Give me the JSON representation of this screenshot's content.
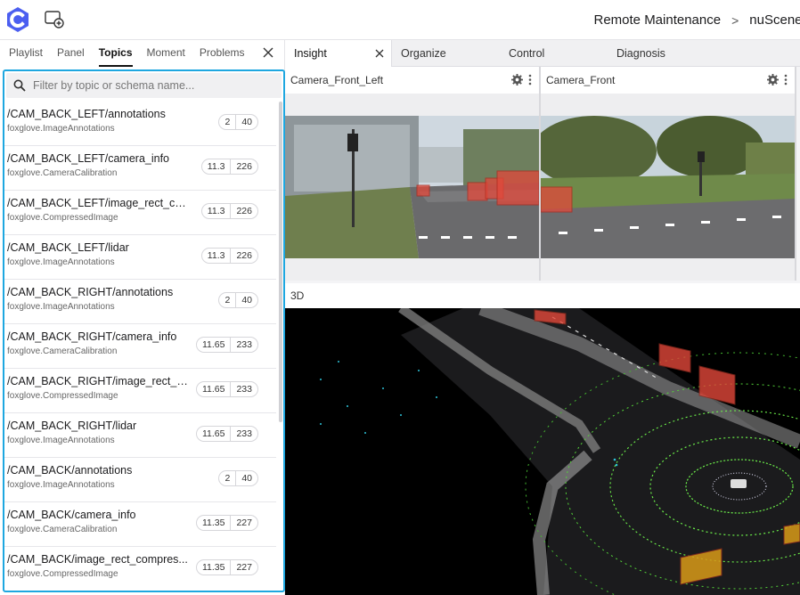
{
  "header": {
    "breadcrumb": [
      "Remote Maintenance",
      "nuScenes"
    ],
    "breadcrumb_separator": ">"
  },
  "sidebar": {
    "tabs": [
      "Playlist",
      "Panel",
      "Topics",
      "Moment",
      "Problems"
    ],
    "active_tab": "Topics",
    "search_placeholder": "Filter by topic or schema name...",
    "topics": [
      {
        "name": "/CAM_BACK_LEFT/annotations",
        "schema": "foxglove.ImageAnnotations",
        "hz": "2",
        "count": "40"
      },
      {
        "name": "/CAM_BACK_LEFT/camera_info",
        "schema": "foxglove.CameraCalibration",
        "hz": "11.3",
        "count": "226"
      },
      {
        "name": "/CAM_BACK_LEFT/image_rect_co...",
        "schema": "foxglove.CompressedImage",
        "hz": "11.3",
        "count": "226"
      },
      {
        "name": "/CAM_BACK_LEFT/lidar",
        "schema": "foxglove.ImageAnnotations",
        "hz": "11.3",
        "count": "226"
      },
      {
        "name": "/CAM_BACK_RIGHT/annotations",
        "schema": "foxglove.ImageAnnotations",
        "hz": "2",
        "count": "40"
      },
      {
        "name": "/CAM_BACK_RIGHT/camera_info",
        "schema": "foxglove.CameraCalibration",
        "hz": "11.65",
        "count": "233"
      },
      {
        "name": "/CAM_BACK_RIGHT/image_rect_c...",
        "schema": "foxglove.CompressedImage",
        "hz": "11.65",
        "count": "233"
      },
      {
        "name": "/CAM_BACK_RIGHT/lidar",
        "schema": "foxglove.ImageAnnotations",
        "hz": "11.65",
        "count": "233"
      },
      {
        "name": "/CAM_BACK/annotations",
        "schema": "foxglove.ImageAnnotations",
        "hz": "2",
        "count": "40"
      },
      {
        "name": "/CAM_BACK/camera_info",
        "schema": "foxglove.CameraCalibration",
        "hz": "11.35",
        "count": "227"
      },
      {
        "name": "/CAM_BACK/image_rect_compres...",
        "schema": "foxglove.CompressedImage",
        "hz": "11.35",
        "count": "227"
      }
    ]
  },
  "layout_tabs": [
    "Insight",
    "Organize",
    "Control",
    "Diagnosis"
  ],
  "active_layout_tab": "Insight",
  "panels": {
    "camera_front_left": "Camera_Front_Left",
    "camera_front": "Camera_Front",
    "view_3d": "3D"
  },
  "colors": {
    "accent": "#1ea7e0",
    "bbox": "#e2483a",
    "lidar_green": "#6cf04a"
  }
}
